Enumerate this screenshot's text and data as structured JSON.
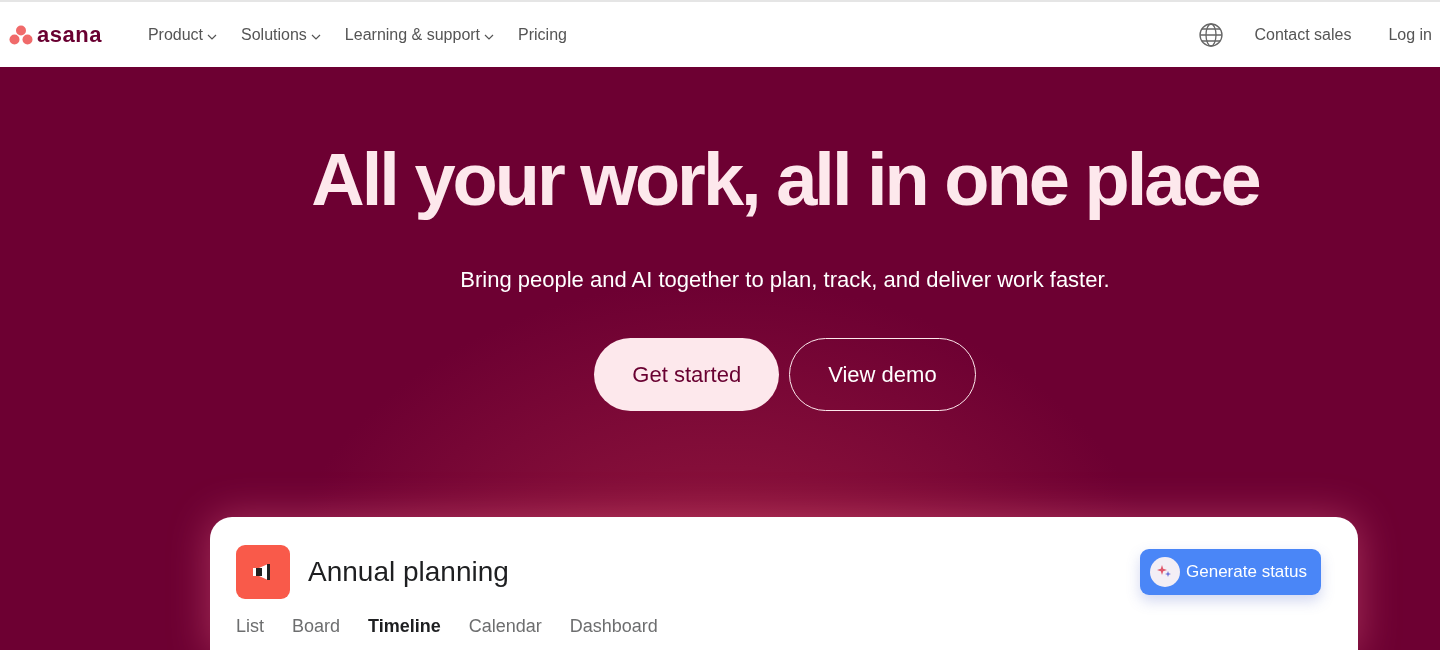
{
  "header": {
    "logo": "asana",
    "nav": [
      {
        "label": "Product",
        "dropdown": true
      },
      {
        "label": "Solutions",
        "dropdown": true
      },
      {
        "label": "Learning & support",
        "dropdown": true
      },
      {
        "label": "Pricing",
        "dropdown": false
      }
    ],
    "actions": [
      "Contact sales",
      "Log in"
    ]
  },
  "hero": {
    "headline": "All your work, all in one place",
    "subtitle": "Bring people and AI together to plan, track, and deliver work faster.",
    "buttons": [
      {
        "label": "Get started",
        "kind": "primary"
      },
      {
        "label": "View demo",
        "kind": "outline"
      }
    ]
  },
  "preview": {
    "project": "Annual planning",
    "action": "Generate status",
    "tabs": [
      {
        "label": "List",
        "selected": false
      },
      {
        "label": "Board",
        "selected": false
      },
      {
        "label": "Timeline",
        "selected": true
      },
      {
        "label": "Calendar",
        "selected": false
      },
      {
        "label": "Dashboard",
        "selected": false
      }
    ]
  }
}
